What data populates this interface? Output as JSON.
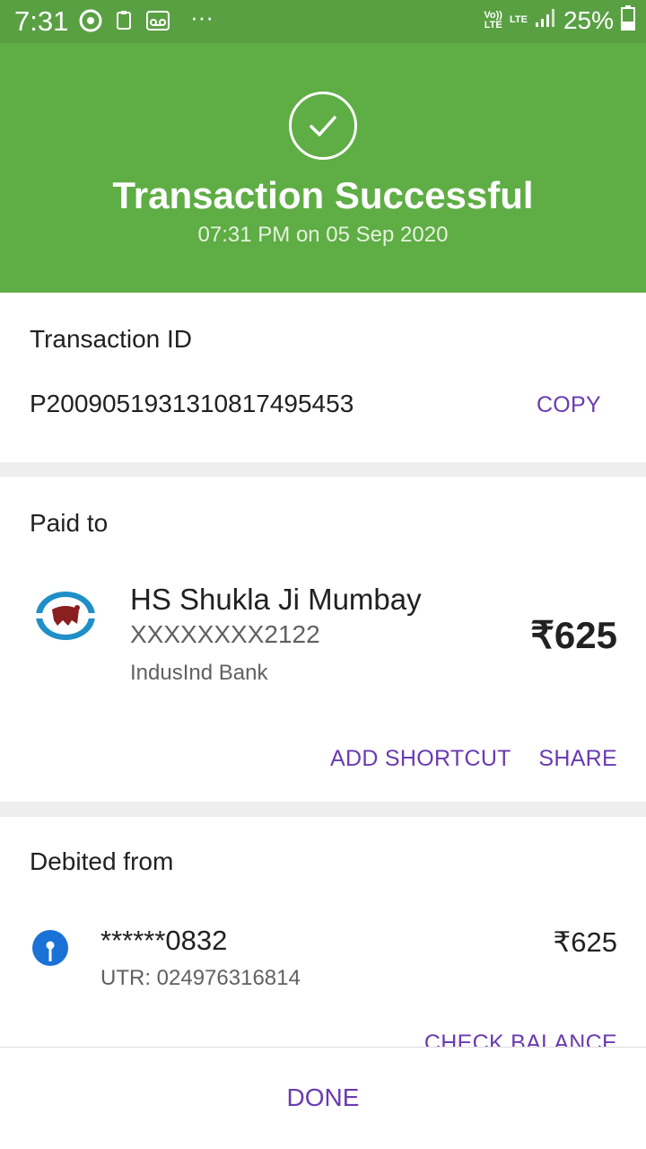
{
  "status_bar": {
    "time": "7:31",
    "battery_percent": "25%",
    "volte_label": "Vo))\nLTE",
    "lte_label": "LTE",
    "more_label": "···"
  },
  "header": {
    "title": "Transaction Successful",
    "datetime": "07:31 PM on 05 Sep 2020",
    "accent_color": "#5fad45"
  },
  "transaction": {
    "label": "Transaction ID",
    "id": "P2009051931310817495453",
    "copy_label": "COPY"
  },
  "paid_to": {
    "label": "Paid to",
    "name": "HS Shukla Ji Mumbay",
    "account": "XXXXXXXX2122",
    "bank": "IndusInd Bank",
    "amount": "₹625",
    "add_shortcut_label": "ADD SHORTCUT",
    "share_label": "SHARE"
  },
  "debited_from": {
    "label": "Debited from",
    "account": "******0832",
    "utr": "UTR: 024976316814",
    "amount": "₹625",
    "check_balance_label": "CHECK BALANCE"
  },
  "footer": {
    "done_label": "DONE",
    "link_color": "#6a3bb0"
  }
}
